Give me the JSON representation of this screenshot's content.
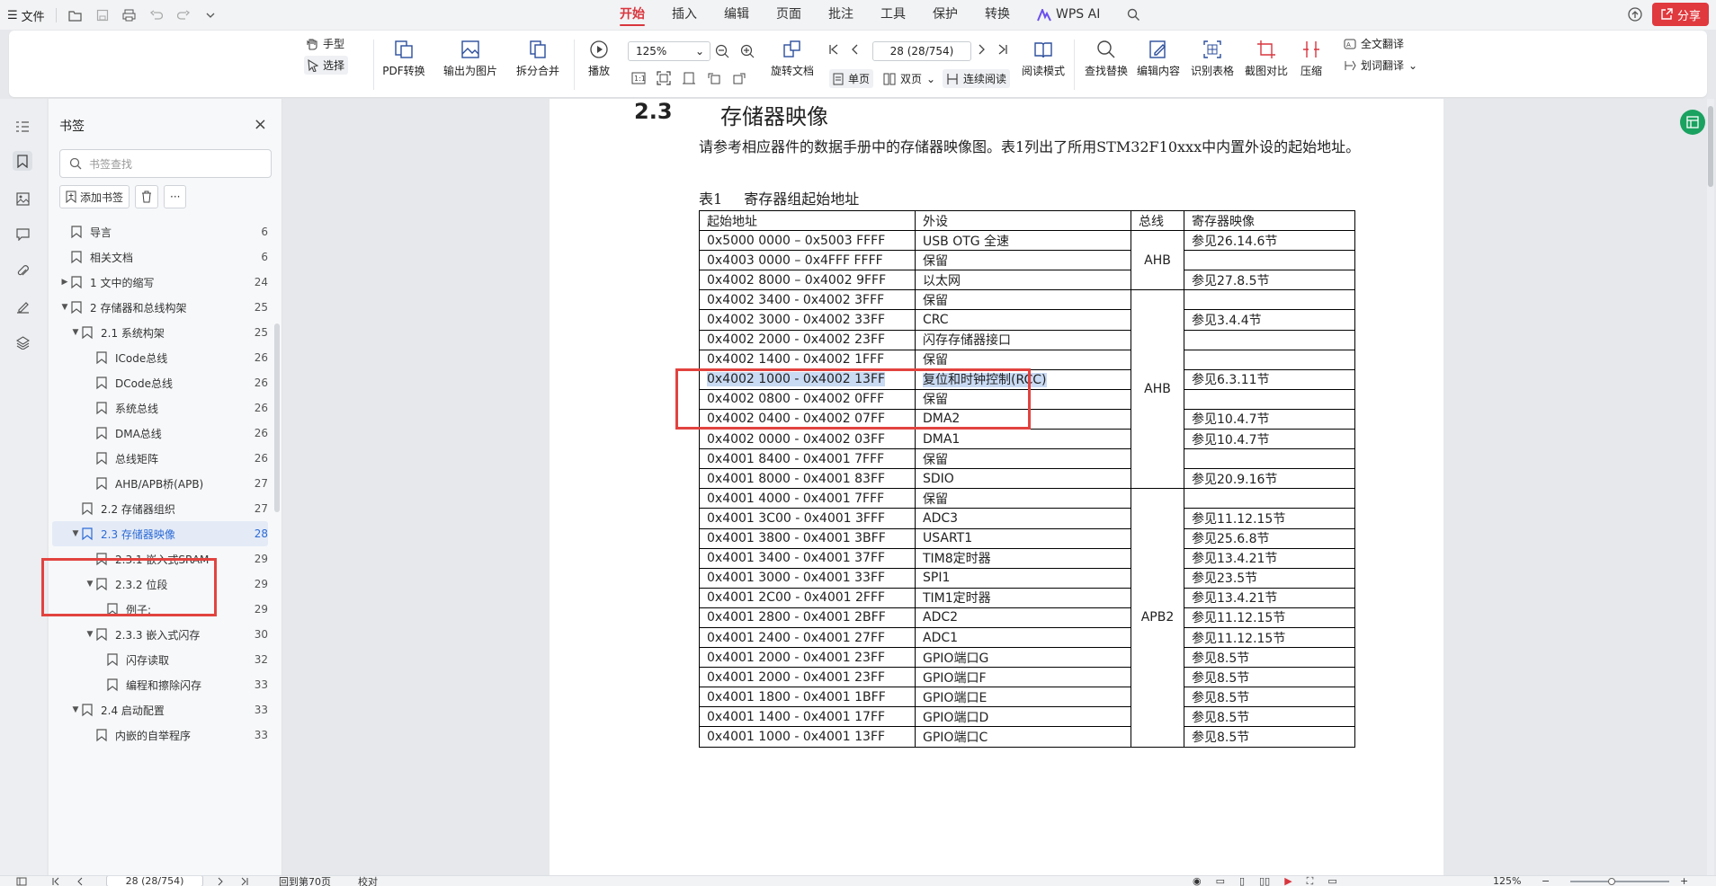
{
  "titlebar": {
    "file_label": "文件",
    "menu": [
      "开始",
      "插入",
      "编辑",
      "页面",
      "批注",
      "工具",
      "保护",
      "转换"
    ],
    "active_menu": "开始",
    "wps_ai": "WPS AI",
    "share": "分享"
  },
  "ribbon": {
    "hand": "手型",
    "select": "选择",
    "pdf_convert": "PDF转换",
    "export_image": "输出为图片",
    "split_merge": "拆分合并",
    "play": "播放",
    "zoom": "125%",
    "rotate": "旋转文档",
    "page_value": "28 (28/754)",
    "single": "单页",
    "double": "双页",
    "continuous": "连续阅读",
    "read_mode": "阅读模式",
    "find_replace": "查找替换",
    "edit_content": "编辑内容",
    "recognize_table": "识别表格",
    "screenshot_compare": "截图对比",
    "compress": "压缩",
    "full_translate": "全文翻译",
    "word_translate": "划词翻译"
  },
  "sidebar": {
    "title": "书签",
    "search_placeholder": "书签查找",
    "add_bookmark": "添加书签",
    "items": [
      {
        "label": "导言",
        "page": "6",
        "level": 0,
        "arrow": ""
      },
      {
        "label": "相关文档",
        "page": "6",
        "level": 0,
        "arrow": ""
      },
      {
        "label": "1 文中的缩写",
        "page": "24",
        "level": 0,
        "arrow": "▶"
      },
      {
        "label": "2 存储器和总线构架",
        "page": "25",
        "level": 0,
        "arrow": "▼"
      },
      {
        "label": "2.1 系统构架",
        "page": "25",
        "level": 1,
        "arrow": "▼"
      },
      {
        "label": "ICode总线",
        "page": "26",
        "level": 2,
        "arrow": ""
      },
      {
        "label": "DCode总线",
        "page": "26",
        "level": 2,
        "arrow": ""
      },
      {
        "label": "系统总线",
        "page": "26",
        "level": 2,
        "arrow": ""
      },
      {
        "label": "DMA总线",
        "page": "26",
        "level": 2,
        "arrow": ""
      },
      {
        "label": "总线矩阵",
        "page": "26",
        "level": 2,
        "arrow": ""
      },
      {
        "label": "AHB/APB桥(APB)",
        "page": "27",
        "level": 2,
        "arrow": ""
      },
      {
        "label": "2.2 存储器组织",
        "page": "27",
        "level": 1,
        "arrow": ""
      },
      {
        "label": "2.3 存储器映像",
        "page": "28",
        "level": 1,
        "arrow": "▼",
        "selected": true
      },
      {
        "label": "2.3.1 嵌入式SRAM",
        "page": "29",
        "level": 2,
        "arrow": ""
      },
      {
        "label": "2.3.2 位段",
        "page": "29",
        "level": 2,
        "arrow": "▼"
      },
      {
        "label": "例子:",
        "page": "29",
        "level": 3,
        "arrow": ""
      },
      {
        "label": "2.3.3 嵌入式闪存",
        "page": "30",
        "level": 2,
        "arrow": "▼"
      },
      {
        "label": "闪存读取",
        "page": "32",
        "level": 3,
        "arrow": ""
      },
      {
        "label": "编程和擦除闪存",
        "page": "33",
        "level": 3,
        "arrow": ""
      },
      {
        "label": "2.4 启动配置",
        "page": "33",
        "level": 1,
        "arrow": "▼"
      },
      {
        "label": "内嵌的自举程序",
        "page": "33",
        "level": 2,
        "arrow": ""
      }
    ]
  },
  "document": {
    "section_number": "2.3",
    "section_title": "存储器映像",
    "paragraph": "请参考相应器件的数据手册中的存储器映像图。表1列出了所用STM32F10xxx中内置外设的起始地址。",
    "caption_label": "表1",
    "caption_text": "寄存器组起始地址",
    "headers": [
      "起始地址",
      "外设",
      "总线",
      "寄存器映像"
    ],
    "rows": [
      [
        "0x5000 0000 – 0x5003 FFFF",
        "USB OTG 全速",
        "参见26.14.6节"
      ],
      [
        "0x4003 0000 – 0x4FFF FFFF",
        "保留",
        ""
      ],
      [
        "0x4002 8000 – 0x4002 9FFF",
        "以太网",
        "参见27.8.5节"
      ],
      [
        "0x4002 3400 - 0x4002 3FFF",
        "保留",
        ""
      ],
      [
        "0x4002 3000 - 0x4002 33FF",
        "CRC",
        "参见3.4.4节"
      ],
      [
        "0x4002 2000 - 0x4002 23FF",
        "闪存存储器接口",
        ""
      ],
      [
        "0x4002 1400 - 0x4002 1FFF",
        "保留",
        ""
      ],
      [
        "0x4002 1000 - 0x4002 13FF",
        "复位和时钟控制(RCC)",
        "参见6.3.11节"
      ],
      [
        "0x4002 0800 - 0x4002 0FFF",
        "保留",
        ""
      ],
      [
        "0x4002 0400 - 0x4002 07FF",
        "DMA2",
        "参见10.4.7节"
      ],
      [
        "0x4002 0000 - 0x4002 03FF",
        "DMA1",
        "参见10.4.7节"
      ],
      [
        "0x4001 8400 - 0x4001 7FFF",
        "保留",
        ""
      ],
      [
        "0x4001 8000 - 0x4001 83FF",
        "SDIO",
        "参见20.9.16节"
      ],
      [
        "0x4001 4000 - 0x4001 7FFF",
        "保留",
        ""
      ],
      [
        "0x4001 3C00 - 0x4001 3FFF",
        "ADC3",
        "参见11.12.15节"
      ],
      [
        "0x4001 3800 - 0x4001 3BFF",
        "USART1",
        "参见25.6.8节"
      ],
      [
        "0x4001 3400 - 0x4001 37FF",
        "TIM8定时器",
        "参见13.4.21节"
      ],
      [
        "0x4001 3000 - 0x4001 33FF",
        "SPI1",
        "参见23.5节"
      ],
      [
        "0x4001 2C00 - 0x4001 2FFF",
        "TIM1定时器",
        "参见13.4.21节"
      ],
      [
        "0x4001 2800 - 0x4001 2BFF",
        "ADC2",
        "参见11.12.15节"
      ],
      [
        "0x4001 2400 - 0x4001 27FF",
        "ADC1",
        "参见11.12.15节"
      ],
      [
        "0x4001 2000 - 0x4001 23FF",
        "GPIO端口G",
        "参见8.5节"
      ],
      [
        "0x4001 2000 - 0x4001 23FF",
        "GPIO端口F",
        "参见8.5节"
      ],
      [
        "0x4001 1800 - 0x4001 1BFF",
        "GPIO端口E",
        "参见8.5节"
      ],
      [
        "0x4001 1400 - 0x4001 17FF",
        "GPIO端口D",
        "参见8.5节"
      ],
      [
        "0x4001 1000 - 0x4001 13FF",
        "GPIO端口C",
        "参见8.5节"
      ]
    ],
    "bus_groups": [
      {
        "label": "AHB",
        "start": 0,
        "span": 3
      },
      {
        "label": "AHB",
        "start": 3,
        "span": 10
      },
      {
        "label": "APB2",
        "start": 13,
        "span": 13
      }
    ]
  },
  "status": {
    "page_value": "28 (28/754)",
    "goto_page": "回到第70页",
    "proof": "校对",
    "zoom": "125%"
  },
  "colors": {
    "accent": "#d9363e",
    "selection": "#2d6bd6",
    "highlight_box": "#e2433f"
  }
}
